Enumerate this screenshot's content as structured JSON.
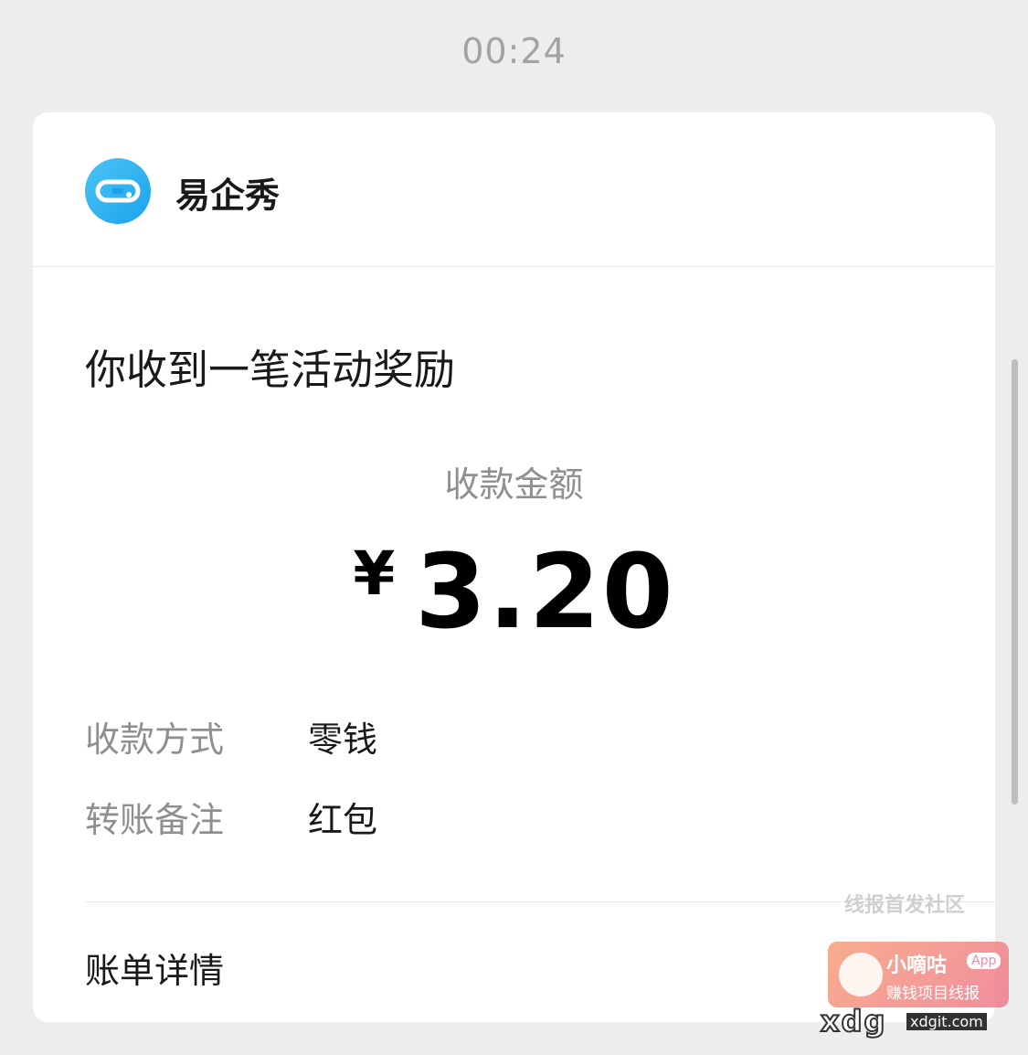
{
  "timestamp": "00:24",
  "card": {
    "app_name": "易企秀",
    "app_icon": "yiqixiu-logo-icon",
    "headline": "你收到一笔活动奖励",
    "amount_label": "收款金额",
    "currency_symbol": "¥",
    "amount_value": "3.20",
    "rows": [
      {
        "label": "收款方式",
        "value": "零钱"
      },
      {
        "label": "转账备注",
        "value": "红包"
      }
    ],
    "bill_detail_label": "账单详情"
  },
  "watermark": {
    "top_text": "线报首发社区",
    "brand": "小嘀咕",
    "app_tag": "App",
    "tagline": "赚钱项目线报",
    "site_big": "xdg",
    "site_small": "xdgit.com"
  },
  "colors": {
    "background": "#ededed",
    "card": "#ffffff",
    "logo_blue": "#1aa3ec",
    "muted_text": "#8f8f8f",
    "primary_text": "#191919"
  }
}
